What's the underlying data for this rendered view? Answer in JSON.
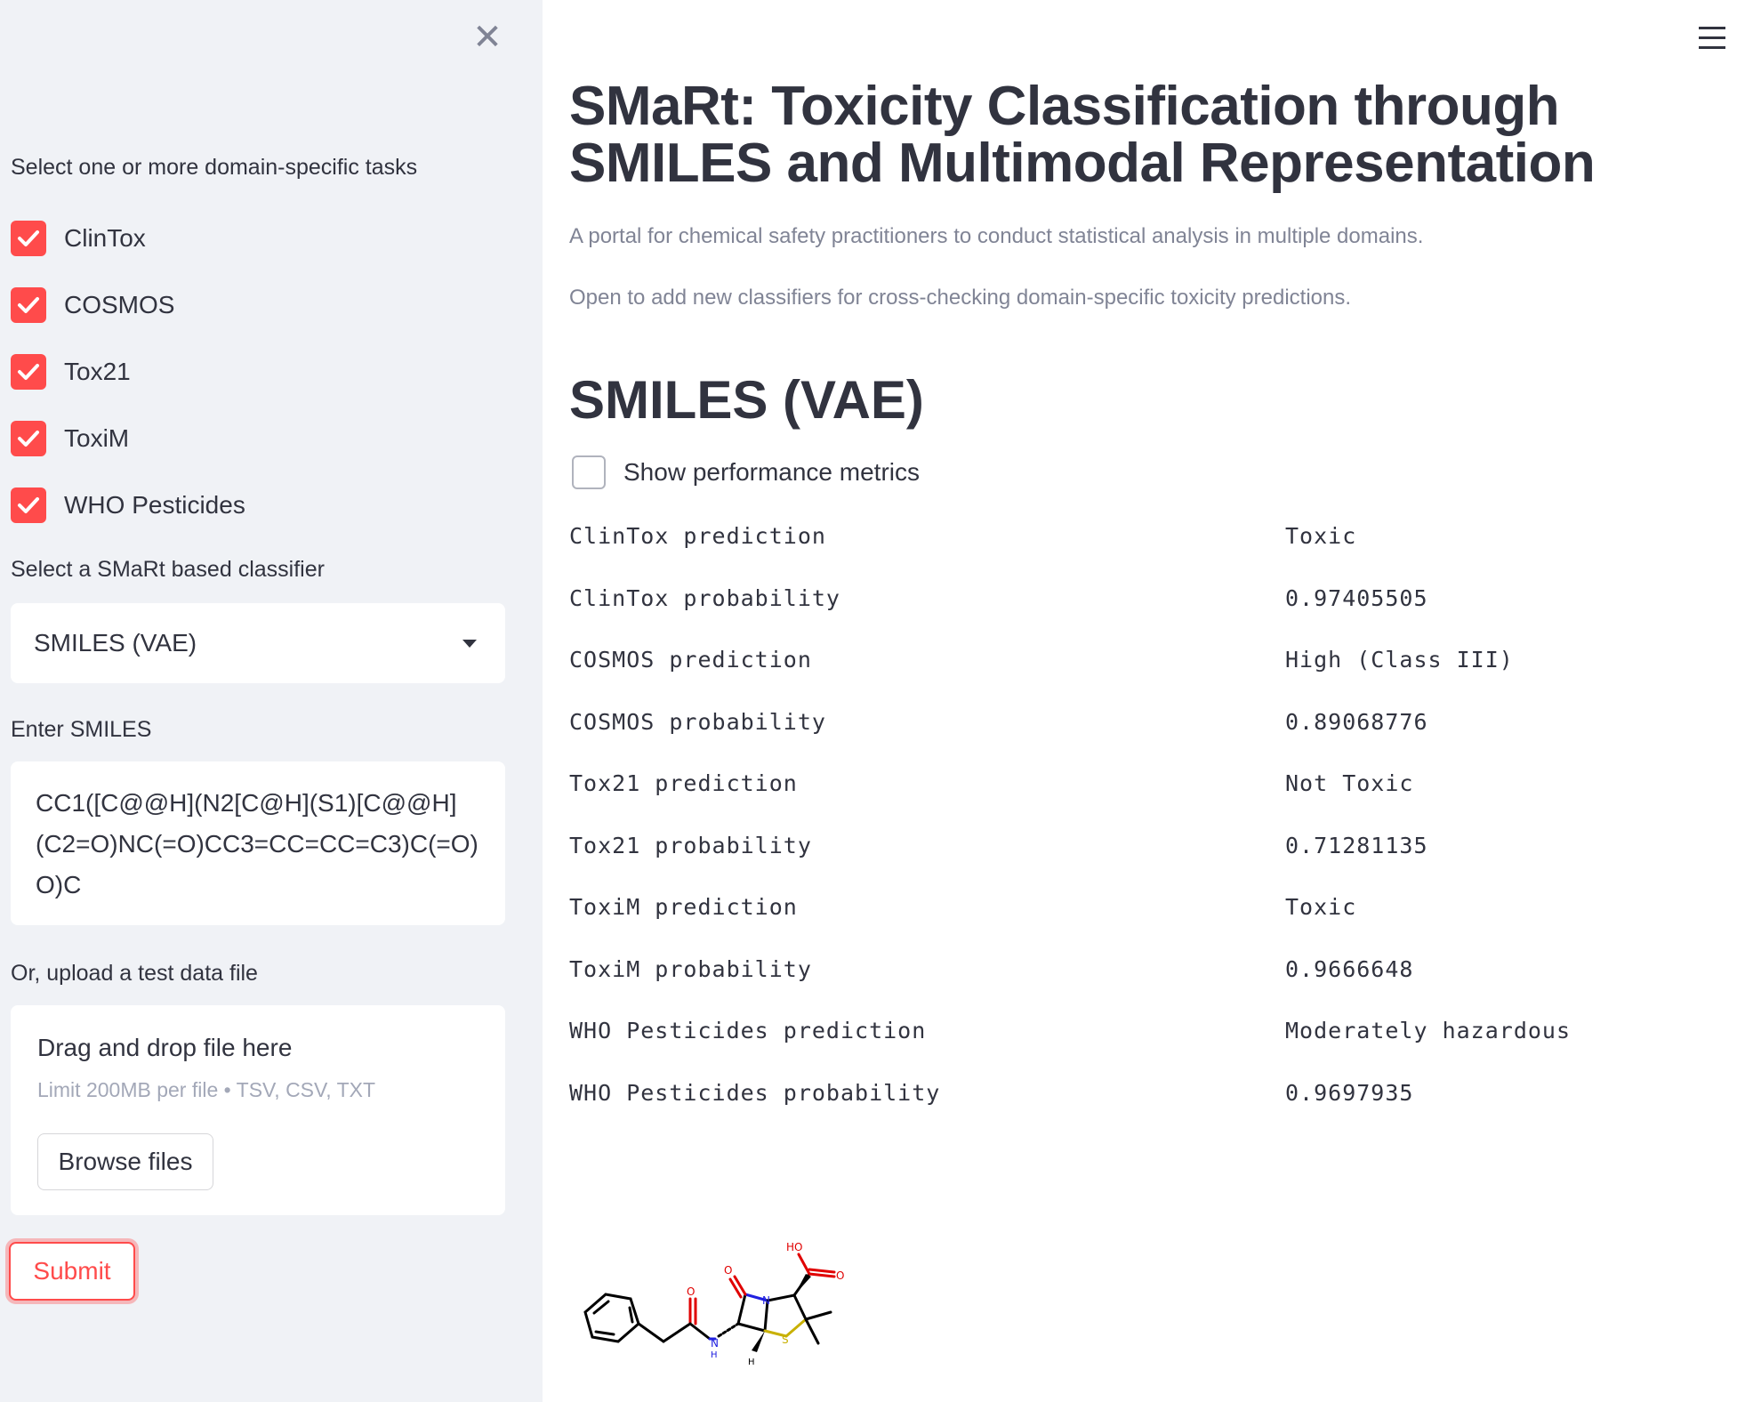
{
  "sidebar": {
    "tasks_label": "Select one or more domain-specific tasks",
    "tasks": [
      {
        "label": "ClinTox",
        "checked": true
      },
      {
        "label": "COSMOS",
        "checked": true
      },
      {
        "label": "Tox21",
        "checked": true
      },
      {
        "label": "ToxiM",
        "checked": true
      },
      {
        "label": "WHO Pesticides",
        "checked": true
      }
    ],
    "classifier_label": "Select a SMaRt based classifier",
    "classifier_value": "SMILES (VAE)",
    "smiles_label": "Enter SMILES",
    "smiles_value": "CC1([C@@H](N2[C@H](S1)[C@@H](C2=O)NC(=O)CC3=CC=CC=C3)C(=O)O)C",
    "upload_label": "Or, upload a test data file",
    "upload_drag": "Drag and drop file here",
    "upload_limit": "Limit 200MB per file • TSV, CSV, TXT",
    "browse_label": "Browse files",
    "submit_label": "Submit"
  },
  "main": {
    "title": "SMaRt: Toxicity Classification through SMILES and Multimodal Representation",
    "description1": "A portal for chemical safety practitioners to conduct statistical analysis in multiple domains.",
    "description2": "Open to add new classifiers for cross-checking domain-specific toxicity predictions.",
    "subheader": "SMILES (VAE)",
    "metrics_checkbox": "Show performance metrics",
    "metrics_checked": false,
    "results": [
      {
        "key": "ClinTox prediction",
        "value": "Toxic"
      },
      {
        "key": "ClinTox probability",
        "value": "0.97405505"
      },
      {
        "key": "COSMOS prediction",
        "value": "High (Class III)"
      },
      {
        "key": "COSMOS probability",
        "value": "0.89068776"
      },
      {
        "key": "Tox21 prediction",
        "value": "Not Toxic"
      },
      {
        "key": "Tox21 probability",
        "value": "0.71281135"
      },
      {
        "key": "ToxiM prediction",
        "value": "Toxic"
      },
      {
        "key": "ToxiM probability",
        "value": "0.9666648"
      },
      {
        "key": "WHO Pesticides prediction",
        "value": "Moderately hazardous"
      },
      {
        "key": "WHO Pesticides probability",
        "value": "0.9697935"
      }
    ],
    "molecule_labels": {
      "ho": "HO",
      "o1": "O",
      "o2": "O",
      "o3": "O",
      "n": "N",
      "nh": "N",
      "h_nh": "H",
      "s": "S",
      "h": "H"
    }
  },
  "colors": {
    "accent": "#ff4b4b",
    "sidebar_bg": "#f0f2f6",
    "text": "#31333f",
    "muted": "#808495"
  }
}
